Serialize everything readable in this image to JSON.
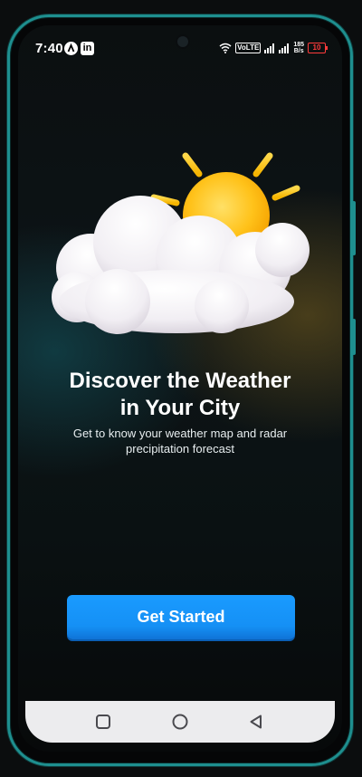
{
  "status_bar": {
    "time": "7:40",
    "notification_icons": [
      "a-circle-icon",
      "linkedin-icon"
    ],
    "volte_label": "VoLTE",
    "net_speed_value": "185",
    "net_speed_unit": "B/s",
    "battery_level": "10",
    "battery_color": "#ff3b3b"
  },
  "onboarding": {
    "illustration": "sun-behind-cloud-icon",
    "title": "Discover the Weather in Your City",
    "title_line1": "Discover the Weather",
    "title_line2": "in Your City",
    "subtitle_line1": "Get to know your weather map and radar",
    "subtitle_line2": "precipitation forecast",
    "cta_label": "Get Started",
    "accent_color": "#1590f5"
  },
  "nav_bar": {
    "buttons": [
      "recent-apps-icon",
      "home-icon",
      "back-icon"
    ]
  }
}
